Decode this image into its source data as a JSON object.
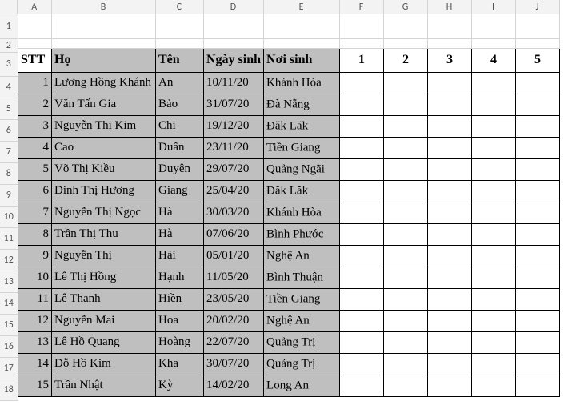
{
  "colHeaders": [
    "A",
    "B",
    "C",
    "D",
    "E",
    "F",
    "G",
    "H",
    "I",
    "J"
  ],
  "rowHeaders": [
    "1",
    "2",
    "3",
    "4",
    "5",
    "6",
    "7",
    "8",
    "9",
    "10",
    "11",
    "12",
    "13",
    "14",
    "15",
    "16",
    "17",
    "18"
  ],
  "tableHeader": {
    "stt": "STT",
    "ho": "Họ",
    "ten": "Tên",
    "ngaysinh": "Ngày sinh",
    "noisinh": "Nơi sinh",
    "f": "1",
    "g": "2",
    "h": "3",
    "i": "4",
    "j": "5"
  },
  "rows": [
    {
      "stt": "1",
      "ho": "Lương Hồng Khánh",
      "ten": "An",
      "ngay": "10/11/20",
      "noi": "Khánh Hòa"
    },
    {
      "stt": "2",
      "ho": "Văn Tấn Gia",
      "ten": "Bảo",
      "ngay": "31/07/20",
      "noi": "Đà Nẵng"
    },
    {
      "stt": "3",
      "ho": "Nguyễn Thị Kim",
      "ten": "Chi",
      "ngay": "19/12/20",
      "noi": "Đăk Lăk"
    },
    {
      "stt": "4",
      "ho": "Cao",
      "ten": "Duẩn",
      "ngay": "23/11/20",
      "noi": "Tiền Giang"
    },
    {
      "stt": "5",
      "ho": "Võ Thị Kiều",
      "ten": "Duyên",
      "ngay": "29/07/20",
      "noi": "Quảng Ngãi"
    },
    {
      "stt": "6",
      "ho": "Đinh Thị Hương",
      "ten": "Giang",
      "ngay": "25/04/20",
      "noi": "Đăk Lăk"
    },
    {
      "stt": "7",
      "ho": "Nguyễn Thị Ngọc",
      "ten": "Hà",
      "ngay": "30/03/20",
      "noi": "Khánh Hòa"
    },
    {
      "stt": "8",
      "ho": "Trần Thị Thu",
      "ten": "Hà",
      "ngay": "07/06/20",
      "noi": "Bình Phước"
    },
    {
      "stt": "9",
      "ho": "Nguyễn Thị",
      "ten": "Hải",
      "ngay": "05/01/20",
      "noi": "Nghệ An"
    },
    {
      "stt": "10",
      "ho": "Lê Thị Hồng",
      "ten": "Hạnh",
      "ngay": "11/05/20",
      "noi": "Bình Thuận"
    },
    {
      "stt": "11",
      "ho": "Lê Thanh",
      "ten": "Hiền",
      "ngay": "23/05/20",
      "noi": "Tiền Giang"
    },
    {
      "stt": "12",
      "ho": "Nguyễn Mai",
      "ten": "Hoa",
      "ngay": "20/02/20",
      "noi": "Nghệ An"
    },
    {
      "stt": "13",
      "ho": "Lê Hồ Quang",
      "ten": "Hoàng",
      "ngay": "22/07/20",
      "noi": "Quảng Trị"
    },
    {
      "stt": "14",
      "ho": "Đỗ Hồ Kim",
      "ten": "Kha",
      "ngay": "30/07/20",
      "noi": "Quảng Trị"
    },
    {
      "stt": "15",
      "ho": "Trần Nhật",
      "ten": "Kỳ",
      "ngay": "14/02/20",
      "noi": "Long An"
    }
  ]
}
